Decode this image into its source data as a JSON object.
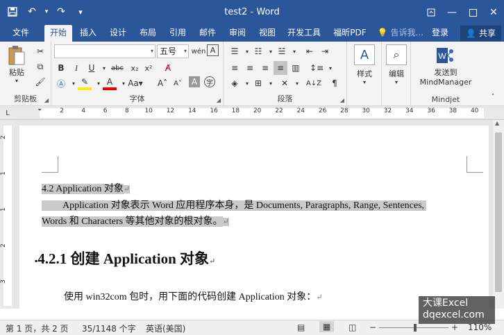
{
  "window": {
    "title": "test2 - Word"
  },
  "quick_access": [
    {
      "name": "save-icon",
      "glyph": "🖫"
    },
    {
      "name": "undo-icon",
      "glyph": "↶"
    },
    {
      "name": "undo-dropdown-icon",
      "glyph": "▾"
    },
    {
      "name": "redo-icon",
      "glyph": "↷"
    },
    {
      "name": "customize-qat-icon",
      "glyph": "≡"
    }
  ],
  "tabs": [
    "文件",
    "开始",
    "插入",
    "设计",
    "布局",
    "引用",
    "邮件",
    "审阅",
    "视图",
    "开发工具",
    "福昕PDF"
  ],
  "tell_me": "告诉我...",
  "login": "登录",
  "share": "共享",
  "ribbon": {
    "clipboard": {
      "paste": "粘贴",
      "label": "剪贴板"
    },
    "font": {
      "label": "字体",
      "size": "五号",
      "name": ""
    },
    "paragraph": {
      "label": "段落"
    },
    "styles": {
      "label": "样式"
    },
    "editing": {
      "label": "编辑"
    },
    "mindjet": {
      "button_line1": "发送到",
      "button_line2": "MindManager",
      "label": "Mindjet"
    }
  },
  "ruler_ticks": [
    "2",
    "4",
    "6",
    "8",
    "10",
    "12",
    "14",
    "16",
    "18",
    "20",
    "22",
    "24",
    "26",
    "28",
    "30",
    "32",
    "34",
    "36",
    "38",
    "40"
  ],
  "vruler_ticks": [
    "2",
    "1",
    "1",
    "2",
    "3"
  ],
  "document": {
    "line1": "4.2 Application  对象",
    "line2": "Application 对象表示 Word 应用程序本身，是 Documents, Paragraphs, Range, Sentences,",
    "line3": "Words 和 Characters 等其他对象的根对象。",
    "heading": "4.2.1  创建 Application 对象",
    "line4": "使用 win32com 包时，用下面的代码创建 Application 对象：",
    "para_mark": "↵"
  },
  "status": {
    "page": "第 1 页，共 2 页",
    "words": "35/1148 个字",
    "language": "英语(美国)",
    "zoom": "110%"
  },
  "watermark": {
    "line1": "大课Excel",
    "line2": "dqexcel.com"
  },
  "colors": {
    "brand": "#2b579a",
    "highlight": "#c9c9c9"
  }
}
